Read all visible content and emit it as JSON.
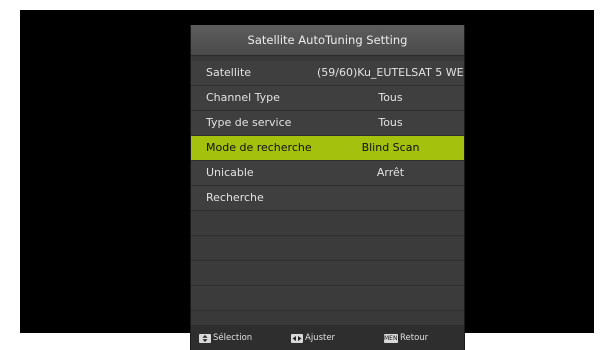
{
  "title": "Satellite AutoTuning Setting",
  "menu": [
    {
      "label": "Satellite",
      "value": "(59/60)Ku_EUTELSAT 5 WE..",
      "selected": false
    },
    {
      "label": "Channel Type",
      "value": "Tous",
      "selected": false
    },
    {
      "label": "Type de service",
      "value": "Tous",
      "selected": false
    },
    {
      "label": "Mode de recherche",
      "value": "Blind Scan",
      "selected": true
    },
    {
      "label": "Unicable",
      "value": "Arrêt",
      "selected": false
    },
    {
      "label": "Recherche",
      "value": "",
      "selected": false
    }
  ],
  "footer": {
    "select_label": "Sélection",
    "adjust_label": "Ajuster",
    "return_label": "Retour",
    "menu_key": "MENU"
  },
  "colors": {
    "highlight": "#a3c10d",
    "panel": "#393939",
    "background": "#000000"
  }
}
